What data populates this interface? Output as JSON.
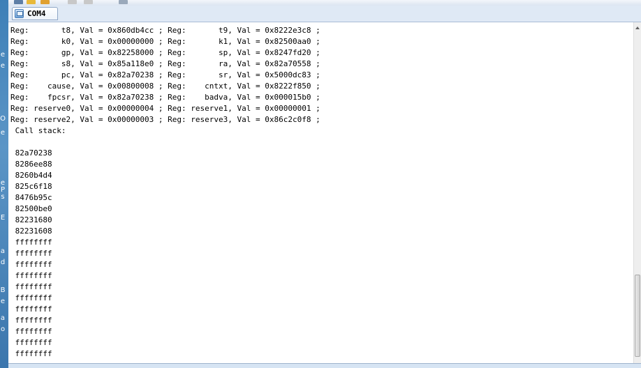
{
  "tab": {
    "label": "COM4"
  },
  "toolbar": {
    "buttons": [
      "new-icon",
      "open-folder-icon",
      "save-icon",
      "print-icon",
      "settings-icon"
    ]
  },
  "left_strip": {
    "glyphs": [
      "e",
      "e",
      "O",
      "e",
      "e",
      "P",
      "s",
      "E",
      "a",
      "d",
      "B",
      "e",
      "a",
      "o"
    ]
  },
  "terminal": {
    "lines": [
      "Reg:       t8, Val = 0x860db4cc ; Reg:       t9, Val = 0x8222e3c8 ;",
      "Reg:       k0, Val = 0x00000000 ; Reg:       k1, Val = 0x82500aa0 ;",
      "Reg:       gp, Val = 0x82258000 ; Reg:       sp, Val = 0x8247fd20 ;",
      "Reg:       s8, Val = 0x85a118e0 ; Reg:       ra, Val = 0x82a70558 ;",
      "Reg:       pc, Val = 0x82a70238 ; Reg:       sr, Val = 0x5000dc83 ;",
      "Reg:    cause, Val = 0x00800008 ; Reg:    cntxt, Val = 0x8222f850 ;",
      "Reg:    fpcsr, Val = 0x82a70238 ; Reg:    badva, Val = 0x000015b0 ;",
      "Reg: reserve0, Val = 0x00000004 ; Reg: reserve1, Val = 0x00000001 ;",
      "Reg: reserve2, Val = 0x00000003 ; Reg: reserve3, Val = 0x86c2c0f8 ;",
      " Call stack:",
      "",
      " 82a70238",
      " 8286ee88",
      " 8260b4d4",
      " 825c6f18",
      " 8476b95c",
      " 82500be0",
      " 82231680",
      " 82231608",
      " ffffffff",
      " ffffffff",
      " ffffffff",
      " ffffffff",
      " ffffffff",
      " ffffffff",
      " ffffffff",
      " ffffffff",
      " ffffffff",
      " ffffffff",
      " ffffffff"
    ]
  },
  "colors": {
    "terminal_bg": "#ffffff",
    "terminal_text": "#000000",
    "chrome": "#dfe9f5",
    "accent": "#3d7fb7"
  }
}
